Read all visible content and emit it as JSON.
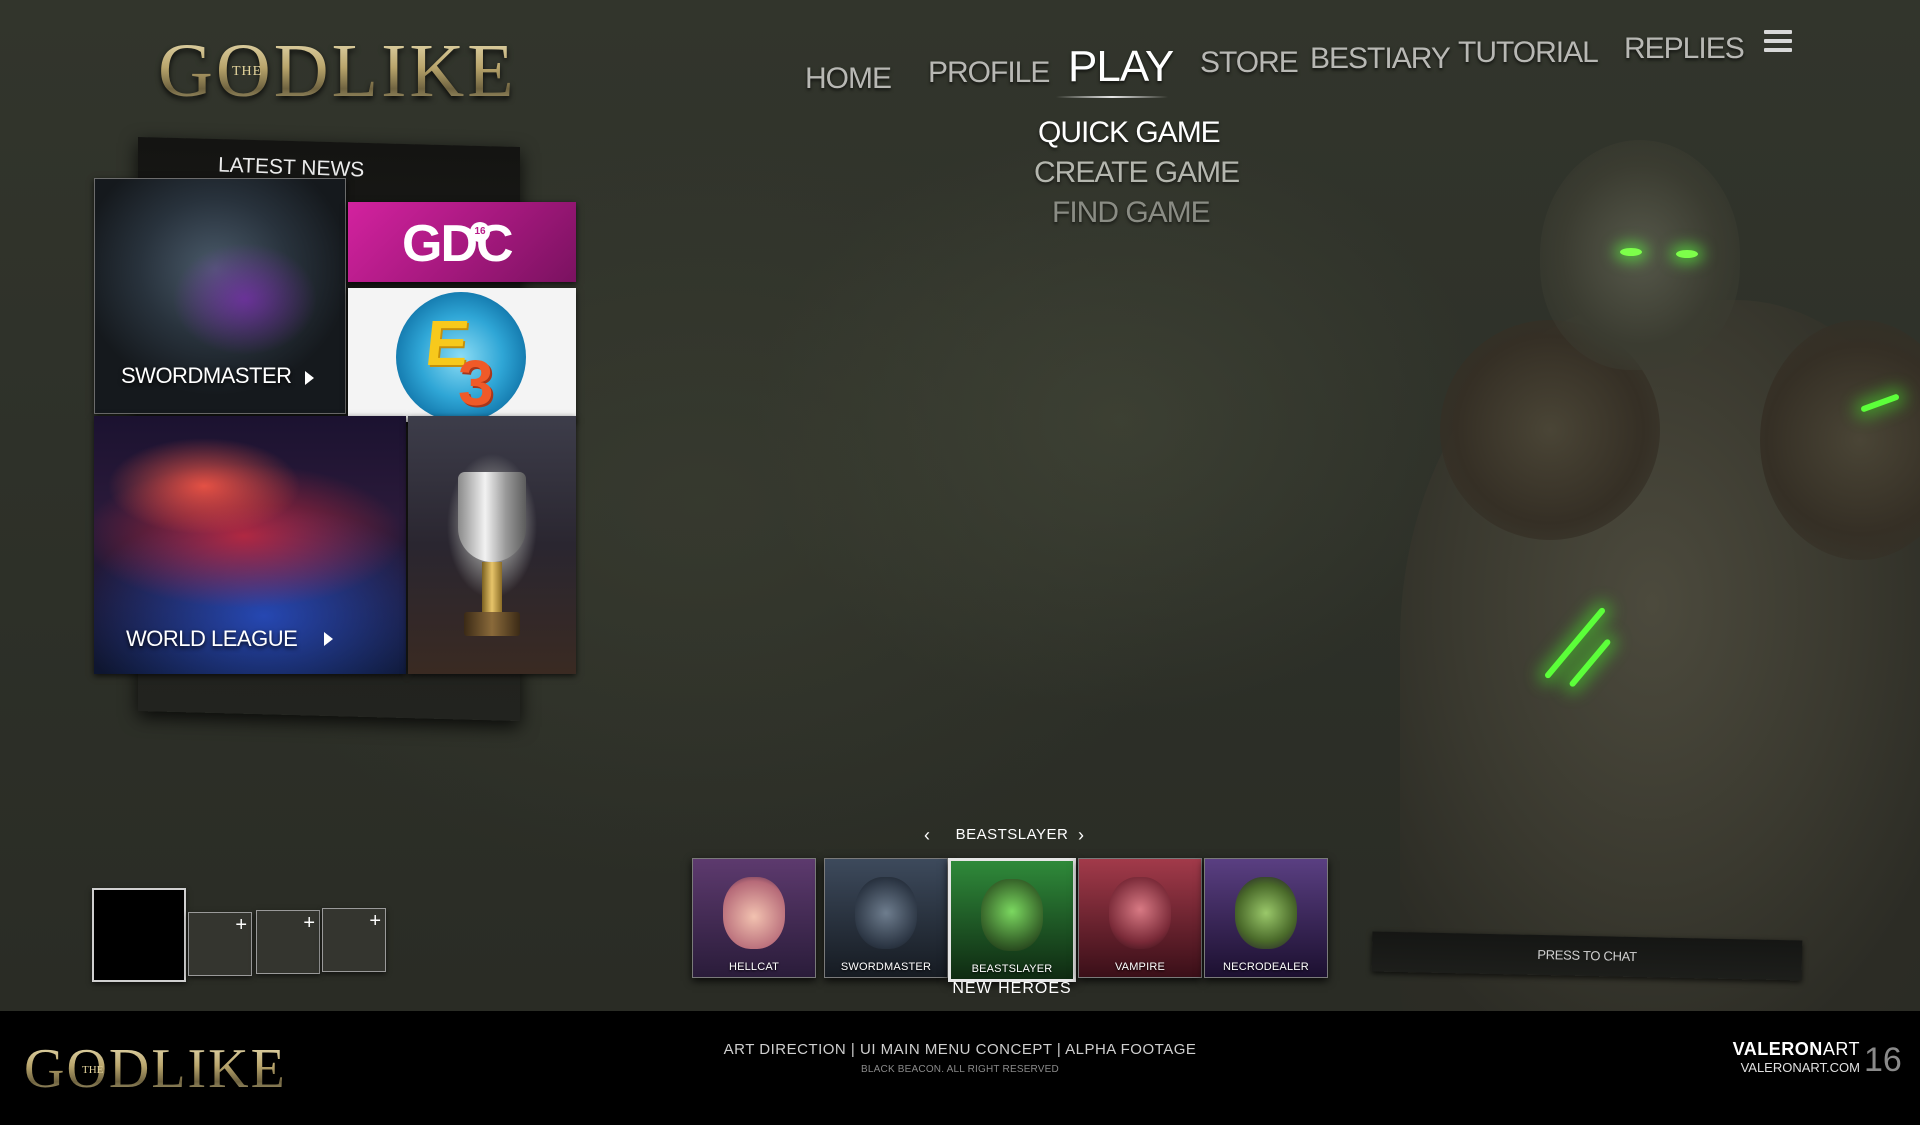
{
  "logo": {
    "title": "GODLIKE",
    "prefix": "THE"
  },
  "nav": {
    "items": [
      "HOME",
      "PROFILE",
      "PLAY",
      "STORE",
      "BESTIARY",
      "TUTORIAL",
      "REPLIES"
    ],
    "active": "PLAY",
    "menu_icon": "hamburger-icon"
  },
  "play_submenu": [
    "QUICK GAME",
    "CREATE GAME",
    "FIND GAME"
  ],
  "news": {
    "title": "LATEST NEWS",
    "tiles": [
      {
        "caption": "SWORDMASTER",
        "arrow_icon": "play-arrow-icon"
      },
      {
        "logo": "GDC",
        "badge": "16"
      },
      {
        "logo_e": "E",
        "logo_3": "3"
      },
      {
        "caption": "WORLD LEAGUE",
        "arrow_icon": "play-arrow-icon"
      },
      {
        "image": "trophy"
      }
    ]
  },
  "slots": {
    "add_symbol": "+"
  },
  "heroes": {
    "prev_icon": "‹",
    "next_icon": "›",
    "selected": "BEASTSLAYER",
    "list": [
      {
        "name": "HELLCAT",
        "color": "#d24a8e"
      },
      {
        "name": "SWORDMASTER",
        "color": "#3d4a5c"
      },
      {
        "name": "BEASTSLAYER",
        "color": "#2f8a3a"
      },
      {
        "name": "VAMPIRE",
        "color": "#a23a4a"
      },
      {
        "name": "NECRODEALER",
        "color": "#5a3f82"
      }
    ],
    "section_label": "NEW  HEROES"
  },
  "chat": {
    "label": "PRESS TO CHAT"
  },
  "footer": {
    "logo": "GODLIKE",
    "logo_prefix": "THE",
    "line1": "ART DIRECTION | UI MAIN MENU CONCEPT | ALPHA FOOTAGE",
    "line2": "BLACK BEACON. ALL RIGHT RESERVED",
    "brand_bold": "VALERON",
    "brand_rest": "ART",
    "brand_site": "VALERONART.COM",
    "year": "16"
  },
  "colors": {
    "accent_green": "#5cff3a",
    "gold": "#c6b98c",
    "gdc_pink": "#d3229f"
  }
}
